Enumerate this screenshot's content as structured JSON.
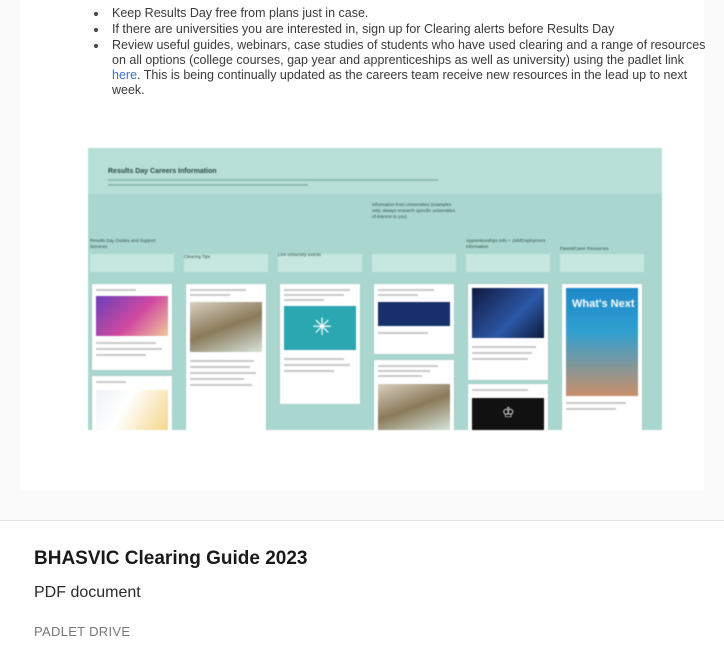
{
  "preview": {
    "bullets": [
      {
        "text": "Keep Results Day free from plans just in case."
      },
      {
        "text": "If there are universities you are interested in, sign up for Clearing alerts before Results Day"
      },
      {
        "text_before": "Review useful guides, webinars, case studies of students who have used clearing and a range of resources on all options (college courses, gap year and apprenticeships as well as university) using the padlet link ",
        "link": "here",
        "text_after": ". This is being continually updated as the careers team receive new resources in the lead up to next week."
      }
    ],
    "board": {
      "title": "Results Day Careers Information",
      "columns": [
        {
          "heading": "Results Day Guides and Support Services"
        },
        {
          "heading": "Clearing Tips"
        },
        {
          "heading": "Live university events"
        },
        {
          "heading": "Information from Universities (examples only, always research specific universities of interest to you)"
        },
        {
          "heading": "Apprenticeships Info + Job/Employment information"
        },
        {
          "heading": "Parent/Carer Resources"
        }
      ],
      "whats_next": "What's Next"
    }
  },
  "card": {
    "title": "BHASVIC Clearing Guide 2023",
    "type": "PDF document",
    "source": "PADLET DRIVE"
  }
}
